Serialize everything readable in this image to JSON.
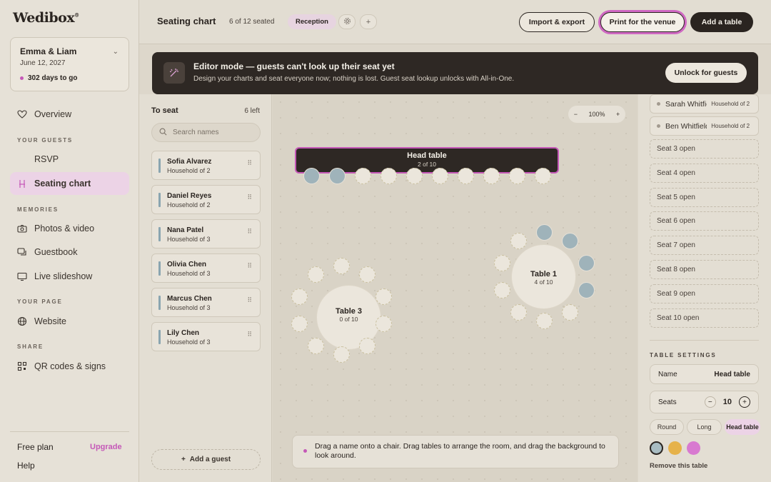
{
  "sidebar": {
    "logo": "Wedibox",
    "event": {
      "names": "Emma & Liam",
      "date": "June 12, 2027",
      "countdown": "302 days to go"
    },
    "nav_overview": "Overview",
    "section_guests": "YOUR GUESTS",
    "nav_rsvp": "RSVP",
    "nav_seating": "Seating chart",
    "section_memories": "MEMORIES",
    "nav_photos": "Photos & video",
    "nav_guestbook": "Guestbook",
    "nav_slideshow": "Live slideshow",
    "section_page": "YOUR PAGE",
    "nav_website": "Website",
    "section_share": "SHARE",
    "nav_qr": "QR codes & signs",
    "plan": "Free plan",
    "upgrade": "Upgrade",
    "help": "Help"
  },
  "topbar": {
    "title": "Seating chart",
    "seated_count": "6 of 12 seated",
    "room_tab": "Reception",
    "import_label": "Import & export",
    "print_label": "Print for the venue",
    "add_table_label": "Add a table"
  },
  "banner": {
    "title": "Editor mode — guests can't look up their seat yet",
    "subtitle": "Design your charts and seat everyone now; nothing is lost. Guest seat lookup unlocks with All-in-One.",
    "button": "Unlock for guests"
  },
  "guest_panel": {
    "title": "To seat",
    "remaining": "6 left",
    "search_placeholder": "Search names",
    "guests": [
      {
        "name": "Sofia Alvarez",
        "household": "Household of 2"
      },
      {
        "name": "Daniel Reyes",
        "household": "Household of 2"
      },
      {
        "name": "Nana Patel",
        "household": "Household of 3"
      },
      {
        "name": "Olivia Chen",
        "household": "Household of 3"
      },
      {
        "name": "Marcus Chen",
        "household": "Household of 3"
      },
      {
        "name": "Lily Chen",
        "household": "Household of 3"
      }
    ],
    "add_guest": "Add a guest"
  },
  "canvas": {
    "zoom_minus": "−",
    "zoom_level": "100%",
    "zoom_plus": "+",
    "head_table": {
      "name": "Head table",
      "count": "2 of 10",
      "seats_taken": 2,
      "seats_total": 10
    },
    "table3": {
      "name": "Table 3",
      "count": "0 of 10",
      "seats_taken": 0,
      "seats_total": 10
    },
    "table1": {
      "name": "Table 1",
      "count": "4 of 10",
      "seats_taken": 4,
      "seats_total": 10
    },
    "tip": "Drag a name onto a chair. Drag tables to arrange the room, and drag the background to look around."
  },
  "right_panel": {
    "seated": [
      {
        "name": "Sarah Whitfield",
        "household": "Household of 2"
      },
      {
        "name": "Ben Whitfield",
        "household": "Household of 2"
      }
    ],
    "open_seats": [
      "Seat 3 open",
      "Seat 4 open",
      "Seat 5 open",
      "Seat 6 open",
      "Seat 7 open",
      "Seat 8 open",
      "Seat 9 open",
      "Seat 10 open"
    ],
    "settings_heading": "TABLE SETTINGS",
    "name_label": "Name",
    "name_value": "Head table",
    "seats_label": "Seats",
    "seats_value": "10",
    "seats_minus": "−",
    "seats_plus": "+",
    "shape_round": "Round",
    "shape_long": "Long",
    "shape_head": "Head table",
    "colors": [
      "#a8bcc2",
      "#e6b24a",
      "#d87ad0"
    ],
    "remove": "Remove this table"
  }
}
